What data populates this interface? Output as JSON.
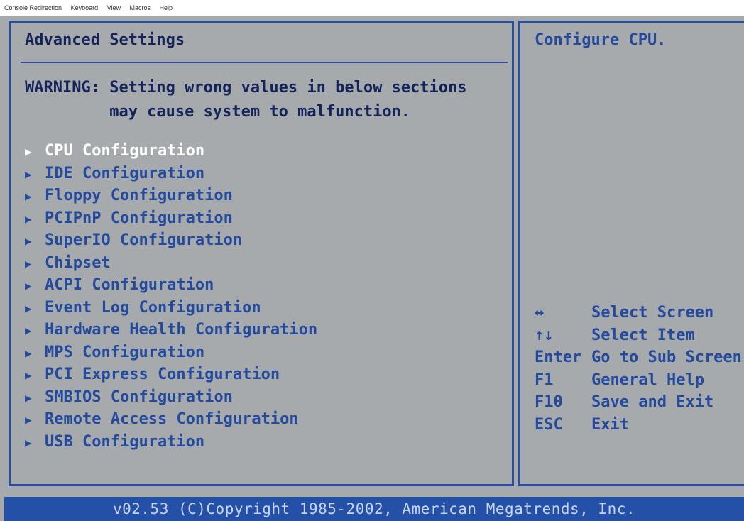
{
  "menubar": {
    "items": [
      "Console Redirection",
      "Keyboard",
      "View",
      "Macros",
      "Help"
    ]
  },
  "left": {
    "title": "Advanced Settings",
    "warning_line1": "WARNING: Setting wrong values in below sections",
    "warning_line2": "         may cause system to malfunction.",
    "items": [
      {
        "label": "CPU Configuration",
        "selected": true
      },
      {
        "label": "IDE Configuration"
      },
      {
        "label": "Floppy Configuration"
      },
      {
        "label": "PCIPnP Configuration"
      },
      {
        "label": "SuperIO Configuration"
      },
      {
        "label": "Chipset"
      },
      {
        "label": "ACPI Configuration"
      },
      {
        "label": "Event Log Configuration"
      },
      {
        "label": "Hardware Health Configuration"
      },
      {
        "label": "MPS Configuration"
      },
      {
        "label": "PCI Express Configuration"
      },
      {
        "label": "SMBIOS Configuration"
      },
      {
        "label": "Remote Access Configuration"
      },
      {
        "label": "USB Configuration"
      }
    ],
    "arrow_icon": "triangle-right-icon"
  },
  "right": {
    "help_text": "Configure CPU.",
    "keys": [
      {
        "key": "↔",
        "action": "Select Screen"
      },
      {
        "key": "↑↓",
        "action": "Select Item"
      },
      {
        "key": "Enter",
        "action": "Go to Sub Screen"
      },
      {
        "key": "F1",
        "action": "General Help"
      },
      {
        "key": "F10",
        "action": "Save and Exit"
      },
      {
        "key": "ESC",
        "action": "Exit"
      }
    ]
  },
  "footer": {
    "text": "v02.53 (C)Copyright 1985-2002, American Megatrends, Inc."
  },
  "colors": {
    "background": "#a7aaad",
    "border": "#2a4d9e",
    "text_blue": "#234a9c",
    "selected": "#ffffff",
    "footer_bg": "#2450a8"
  }
}
